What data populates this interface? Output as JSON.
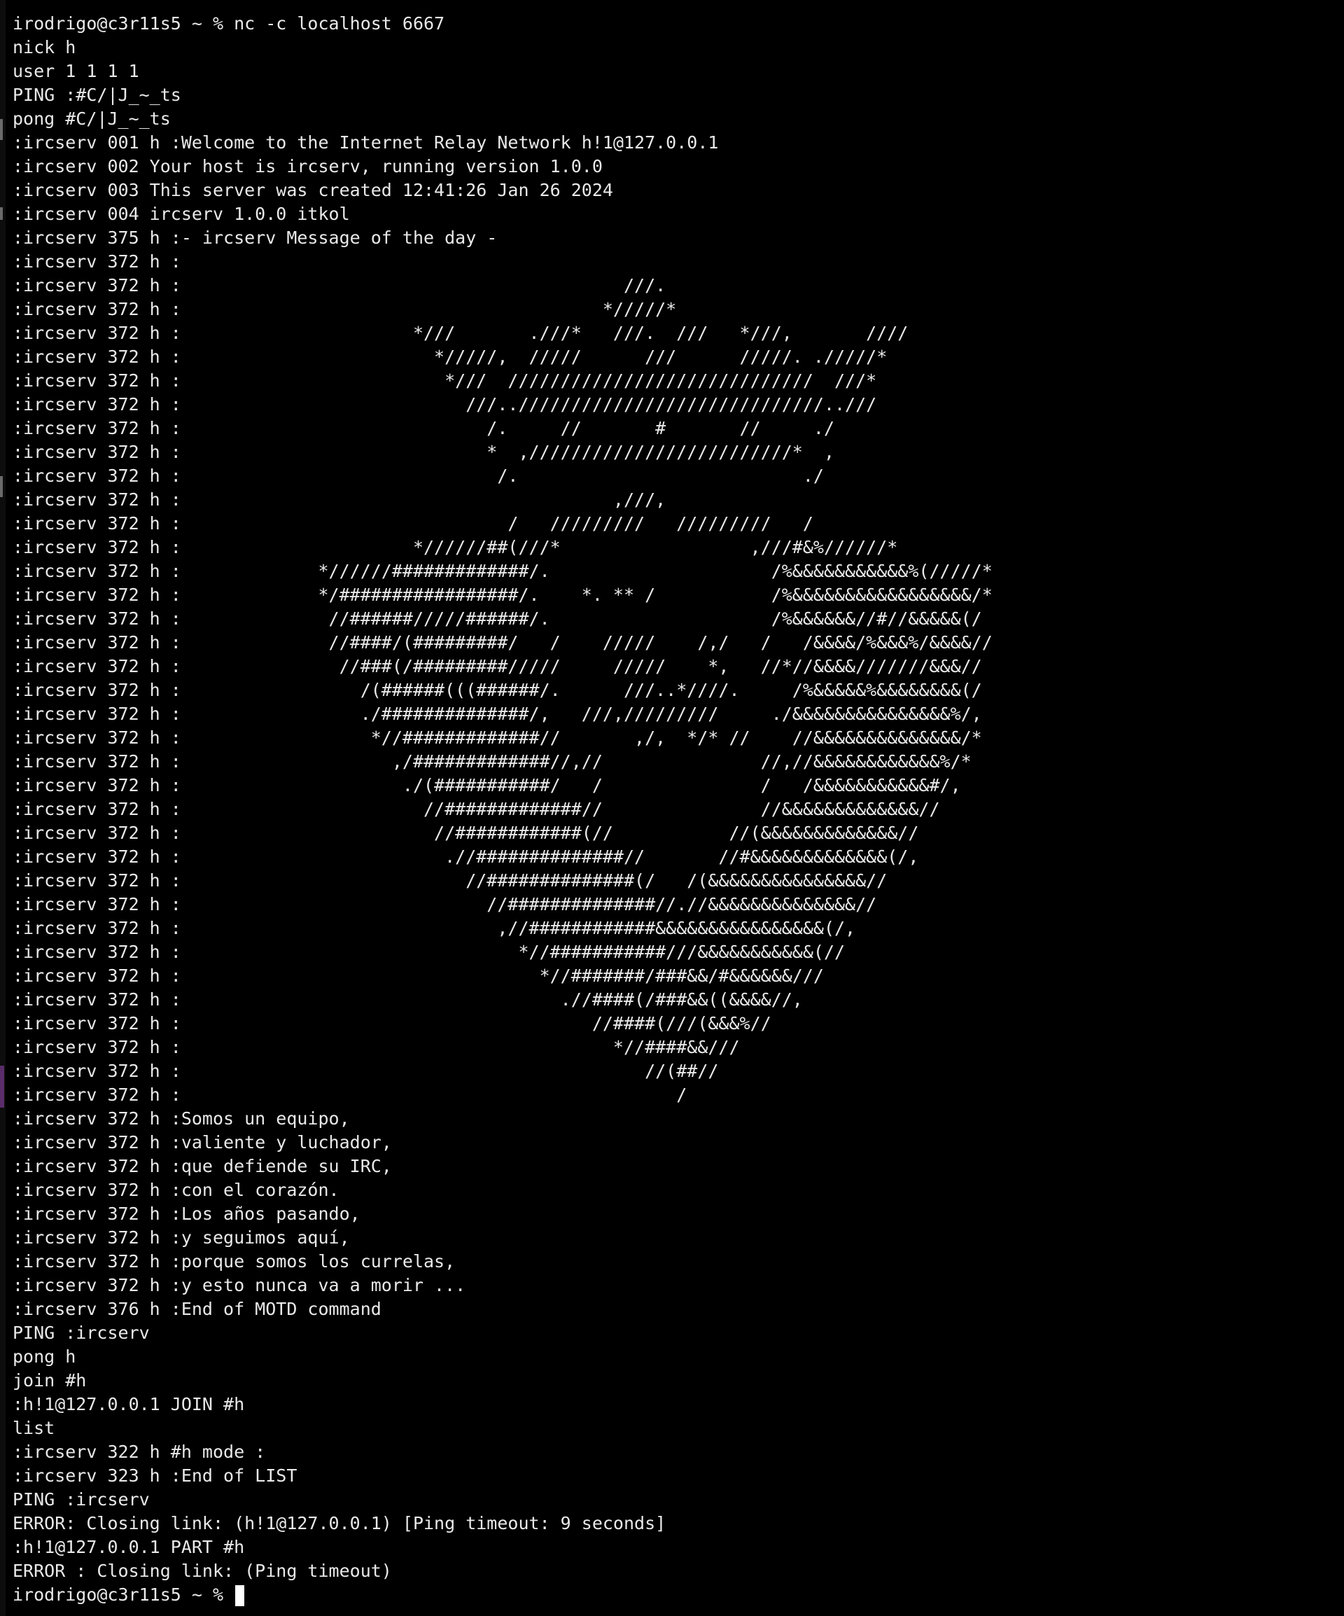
{
  "terminal": {
    "lines": [
      "irodrigo@c3r11s5 ~ % nc -c localhost 6667",
      "nick h",
      "user 1 1 1 1",
      "PING :#C/|J_~_ts",
      "pong #C/|J_~_ts",
      ":ircserv 001 h :Welcome to the Internet Relay Network h!1@127.0.0.1",
      ":ircserv 002 Your host is ircserv, running version 1.0.0",
      ":ircserv 003 This server was created 12:41:26 Jan 26 2024",
      ":ircserv 004 ircserv 1.0.0 itkol",
      ":ircserv 375 h :- ircserv Message of the day -",
      ":ircserv 372 h :",
      ":ircserv 372 h :                                          ///.",
      ":ircserv 372 h :                                        */////*",
      ":ircserv 372 h :                      *///       .///*   ///.  ///   *///,       ////",
      ":ircserv 372 h :                        */////,  /////      ///      /////. ./////*",
      ":ircserv 372 h :                         *///  /////////////////////////////  ///*",
      ":ircserv 372 h :                           ///../////////////////////////////..///",
      ":ircserv 372 h :                             /.     //       #       //     ./",
      ":ircserv 372 h :                             *  ,/////////////////////////*  ,",
      ":ircserv 372 h :                              /.                           ./",
      ":ircserv 372 h :                                         ,///,",
      ":ircserv 372 h :                               /   /////////   /////////   /",
      ":ircserv 372 h :                      *//////##(///*                  ,///#&%//////*",
      ":ircserv 372 h :             *//////#############/.                     /%&&&&&&&&&&&%(/////*",
      ":ircserv 372 h :             */#################/.    *. ** /           /%&&&&&&&&&&&&&&&&&/*",
      ":ircserv 372 h :              //######/////######/.                     /%&&&&&&//#//&&&&&(/",
      ":ircserv 372 h :              //####/(#########/   /    /////    /,/   /   /&&&&/%&&&%/&&&&//",
      ":ircserv 372 h :               //###(/#########/////     /////    *,   //*//&&&&///////&&&//",
      ":ircserv 372 h :                 /(######(((######/.      ///..*////.     /%&&&&&%&&&&&&&&(/",
      ":ircserv 372 h :                 ./##############/,   ///,/////////     ./&&&&&&&&&&&&&&&%/,",
      ":ircserv 372 h :                  *//#############//       ,/,  */* //    //&&&&&&&&&&&&&&/*",
      ":ircserv 372 h :                    ,/#############//,//               //,//&&&&&&&&&&&&%/*",
      ":ircserv 372 h :                     ./(###########/   /               /   /&&&&&&&&&&&#/,",
      ":ircserv 372 h :                       //#############//               //&&&&&&&&&&&&&//",
      ":ircserv 372 h :                        //############(//           //(&&&&&&&&&&&&&//",
      ":ircserv 372 h :                         .//##############//       //#&&&&&&&&&&&&&(/,",
      ":ircserv 372 h :                           //##############(/   /(&&&&&&&&&&&&&&&//",
      ":ircserv 372 h :                             //##############//.//&&&&&&&&&&&&&&//",
      ":ircserv 372 h :                              ,//############&&&&&&&&&&&&&&&&(/,",
      ":ircserv 372 h :                                *//###########///&&&&&&&&&&&(//",
      ":ircserv 372 h :                                  *//#######/###&&/#&&&&&&///",
      ":ircserv 372 h :                                    .//####(/###&&((&&&&//,",
      ":ircserv 372 h :                                       //####(///(&&&%//",
      ":ircserv 372 h :                                         *//####&&///",
      ":ircserv 372 h :                                            //(##//",
      ":ircserv 372 h :                                               /",
      ":ircserv 372 h :Somos un equipo,",
      ":ircserv 372 h :valiente y luchador,",
      ":ircserv 372 h :que defiende su IRC,",
      ":ircserv 372 h :con el corazón.",
      ":ircserv 372 h :Los años pasando,",
      ":ircserv 372 h :y seguimos aquí,",
      ":ircserv 372 h :porque somos los currelas,",
      ":ircserv 372 h :y esto nunca va a morir ...",
      ":ircserv 376 h :End of MOTD command",
      "PING :ircserv",
      "pong h",
      "join #h",
      ":h!1@127.0.0.1 JOIN #h",
      "list",
      ":ircserv 322 h #h mode :",
      ":ircserv 323 h :End of LIST",
      "PING :ircserv",
      "ERROR: Closing link: (h!1@127.0.0.1) [Ping timeout: 9 seconds]",
      ":h!1@127.0.0.1 PART #h",
      "ERROR : Closing link: (Ping timeout)"
    ],
    "prompt": "irodrigo@c3r11s5 ~ % "
  }
}
